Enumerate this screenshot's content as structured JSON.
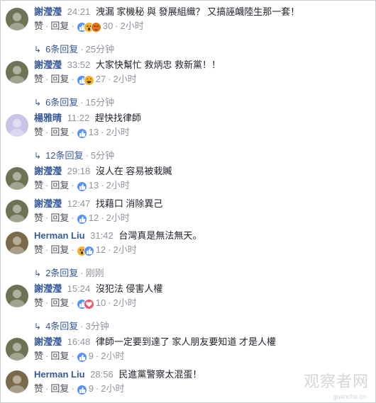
{
  "labels": {
    "like": "赞",
    "reply": "回复"
  },
  "comments": [
    {
      "author": "謝瀅瀅",
      "timestamp": "24:21",
      "text": "洩漏   家機秘 與 發展組織？ 又搞誣衊陸生那一套！",
      "reactions": [
        "like",
        "wow",
        "angry"
      ],
      "count": "30",
      "time": "2小时",
      "replies": {
        "text": "6条回复",
        "time": "25分钟"
      }
    },
    {
      "author": "謝瀅瀅",
      "timestamp": "33:52",
      "text": "大家快幫忙 救炳忠 救新黨！！",
      "reactions": [
        "like",
        "haha"
      ],
      "count": "27",
      "time": "2小时",
      "replies": {
        "text": "6条回复",
        "time": "15分钟"
      }
    },
    {
      "author": "楊雅晴",
      "timestamp": "11:22",
      "text": "趕快找律師",
      "reactions": [
        "like"
      ],
      "count": "13",
      "time": "2小时",
      "replies": {
        "text": "12条回复",
        "time": "5分钟"
      }
    },
    {
      "author": "謝瀅瀅",
      "timestamp": "29:18",
      "text": "沒人在 容易被栽贓",
      "reactions": [
        "like"
      ],
      "count": "13",
      "time": "2小时"
    },
    {
      "author": "謝瀅瀅",
      "timestamp": "12:47",
      "text": "找藉口 消除異己",
      "reactions": [
        "like"
      ],
      "count": "12",
      "time": "2小时"
    },
    {
      "author": "Herman Liu",
      "timestamp": "31:42",
      "text": "台灣真是無法無天。",
      "reactions": [
        "wow",
        "like"
      ],
      "count": "12",
      "time": "2小时",
      "replies": {
        "text": "2条回复",
        "time": "刚刚"
      }
    },
    {
      "author": "謝瀅瀅",
      "timestamp": "15:24",
      "text": "沒犯法 侵害人權",
      "reactions": [
        "like",
        "love"
      ],
      "count": "10",
      "time": "2小时",
      "replies": {
        "text": "4条回复",
        "time": "3分钟"
      }
    },
    {
      "author": "謝瀅瀅",
      "timestamp": "16:48",
      "text": "律師一定要到達了 家人朋友要知道 才是人權",
      "reactions": [
        "like"
      ],
      "count": "9",
      "time": "2小时"
    },
    {
      "author": "Herman Liu",
      "timestamp": "28:56",
      "text": "民進黨警察太混蛋！",
      "reactions": [
        "like"
      ],
      "count": "9",
      "time": "2小时"
    }
  ],
  "watermark": {
    "main": "观察者网",
    "sub": "guancha.cn"
  }
}
